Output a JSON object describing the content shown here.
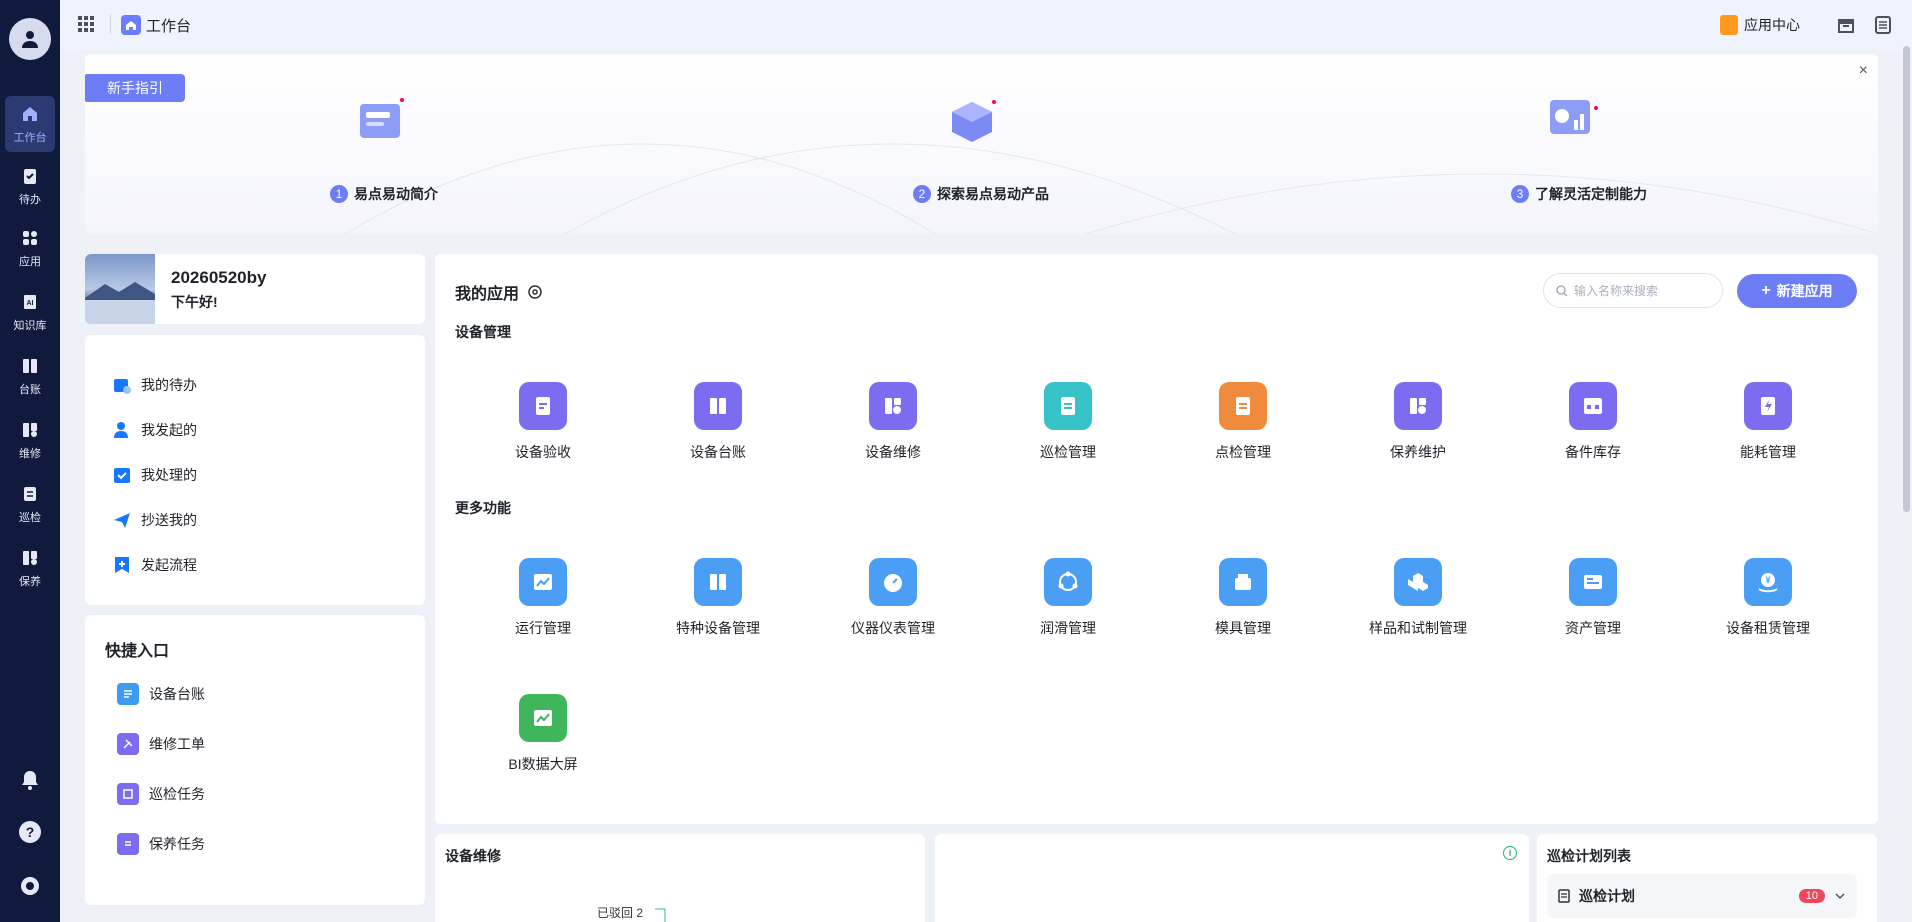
{
  "rail": {
    "items": [
      {
        "label": "工作台",
        "icon": "home-icon",
        "active": true
      },
      {
        "label": "待办",
        "icon": "clipboard-check-icon"
      },
      {
        "label": "应用",
        "icon": "apps-icon"
      },
      {
        "label": "知识库",
        "icon": "ai-book-icon"
      },
      {
        "label": "台账",
        "icon": "ledger-icon"
      },
      {
        "label": "维修",
        "icon": "repair-icon"
      },
      {
        "label": "巡检",
        "icon": "inspection-icon"
      },
      {
        "label": "保养",
        "icon": "maintenance-icon"
      }
    ],
    "bottom_icons": [
      "bell-icon",
      "help-icon",
      "settings-icon"
    ]
  },
  "topbar": {
    "title": "工作台",
    "app_center": "应用中心"
  },
  "guide": {
    "tag": "新手指引",
    "close": "×",
    "steps": [
      {
        "num": "1",
        "label": "易点易动简介"
      },
      {
        "num": "2",
        "label": "探索易点易动产品"
      },
      {
        "num": "3",
        "label": "了解灵活定制能力"
      }
    ]
  },
  "user": {
    "name": "20260520by",
    "greeting": "下午好!"
  },
  "todo": {
    "items": [
      {
        "label": "我的待办",
        "icon": "calendar-icon"
      },
      {
        "label": "我发起的",
        "icon": "person-icon"
      },
      {
        "label": "我处理的",
        "icon": "checkbox-icon"
      },
      {
        "label": "抄送我的",
        "icon": "send-icon"
      },
      {
        "label": "发起流程",
        "icon": "flow-add-icon"
      }
    ]
  },
  "quick": {
    "title": "快捷入口",
    "items": [
      {
        "label": "设备台账",
        "color": "#3d9bf0"
      },
      {
        "label": "维修工单",
        "color": "#7b6cf0"
      },
      {
        "label": "巡检任务",
        "color": "#7b6cf0"
      },
      {
        "label": "保养任务",
        "color": "#7b6cf0"
      }
    ]
  },
  "apps": {
    "title": "我的应用",
    "search_placeholder": "输入名称来搜索",
    "new_button": "新建应用",
    "sections": [
      {
        "title": "设备管理",
        "items": [
          {
            "label": "设备验收",
            "color": "#7b6cf0"
          },
          {
            "label": "设备台账",
            "color": "#7b6cf0"
          },
          {
            "label": "设备维修",
            "color": "#7b6cf0"
          },
          {
            "label": "巡检管理",
            "color": "#36c3c8"
          },
          {
            "label": "点检管理",
            "color": "#f08a3c"
          },
          {
            "label": "保养维护",
            "color": "#7b6cf0"
          },
          {
            "label": "备件库存",
            "color": "#7b6cf0"
          },
          {
            "label": "能耗管理",
            "color": "#7b6cf0"
          }
        ]
      },
      {
        "title": "更多功能",
        "items": [
          {
            "label": "运行管理",
            "color": "#4a9ff5"
          },
          {
            "label": "特种设备管理",
            "color": "#4a9ff5"
          },
          {
            "label": "仪器仪表管理",
            "color": "#4a9ff5"
          },
          {
            "label": "润滑管理",
            "color": "#4a9ff5"
          },
          {
            "label": "模具管理",
            "color": "#4a9ff5"
          },
          {
            "label": "样品和试制管理",
            "color": "#4a9ff5"
          },
          {
            "label": "资产管理",
            "color": "#4a9ff5"
          },
          {
            "label": "设备租赁管理",
            "color": "#4a9ff5"
          },
          {
            "label": "BI数据大屏",
            "color": "#3fb55c"
          }
        ]
      }
    ]
  },
  "repair": {
    "title": "设备维修",
    "returned_label": "已驳回 2"
  },
  "plan": {
    "title": "巡检计划列表",
    "row_label": "巡检计划",
    "badge": "10"
  }
}
